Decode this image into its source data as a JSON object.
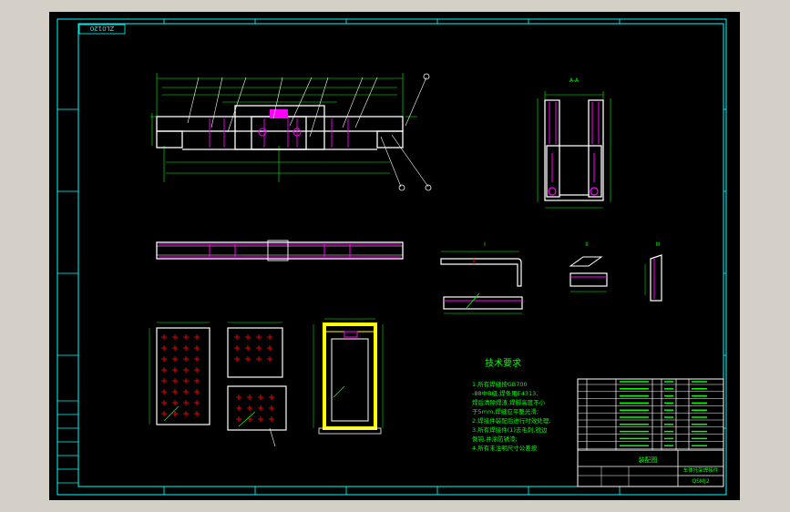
{
  "drawing": {
    "code_stamp": "ZL0120",
    "tech_req_title": "技术要求",
    "tech_req_lines": [
      "1.所有焊缝按GB700",
      "-88中B级,焊条用E4313,",
      "焊后清除焊渣,焊脚高度不小",
      "于5mm,焊缝应平整光滑;",
      "2.焊接件装配后进行时效处理,",
      "3.所有焊接件(1)去毛刺,锐边",
      "倒钝,并涂防锈漆;",
      "4.所有未注明尺寸公差按"
    ],
    "part_title": "车体托架焊接件",
    "sub_title": "装配图",
    "part_code": "QSMJ2",
    "colors": {
      "frame": "#00ffff",
      "outline": "#ffffff",
      "weld": "#ff00ff",
      "dim": "#00ff00",
      "annot": "#ffff00",
      "cross": "#ff0000",
      "blue": "#4060ff"
    }
  }
}
